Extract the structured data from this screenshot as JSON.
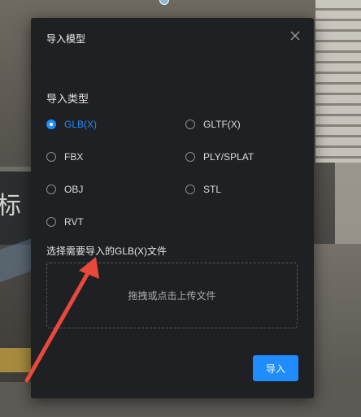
{
  "background": {
    "wall_sign_text": "标"
  },
  "dialog": {
    "title": "导入模型",
    "close_icon": "close-icon",
    "import_type_label": "导入类型",
    "options": [
      {
        "label": "GLB(X)",
        "checked": true
      },
      {
        "label": "GLTF(X)",
        "checked": false
      },
      {
        "label": "FBX",
        "checked": false
      },
      {
        "label": "PLY/SPLAT",
        "checked": false
      },
      {
        "label": "OBJ",
        "checked": false
      },
      {
        "label": "STL",
        "checked": false
      },
      {
        "label": "RVT",
        "checked": false
      }
    ],
    "file_select_label": "选择需要导入的GLB(X)文件",
    "dropzone_text": "拖拽或点击上传文件",
    "import_button": "导入"
  },
  "colors": {
    "accent": "#1f8cff",
    "dialog_bg": "#1f2023",
    "annotation_arrow": "#e8493a"
  }
}
